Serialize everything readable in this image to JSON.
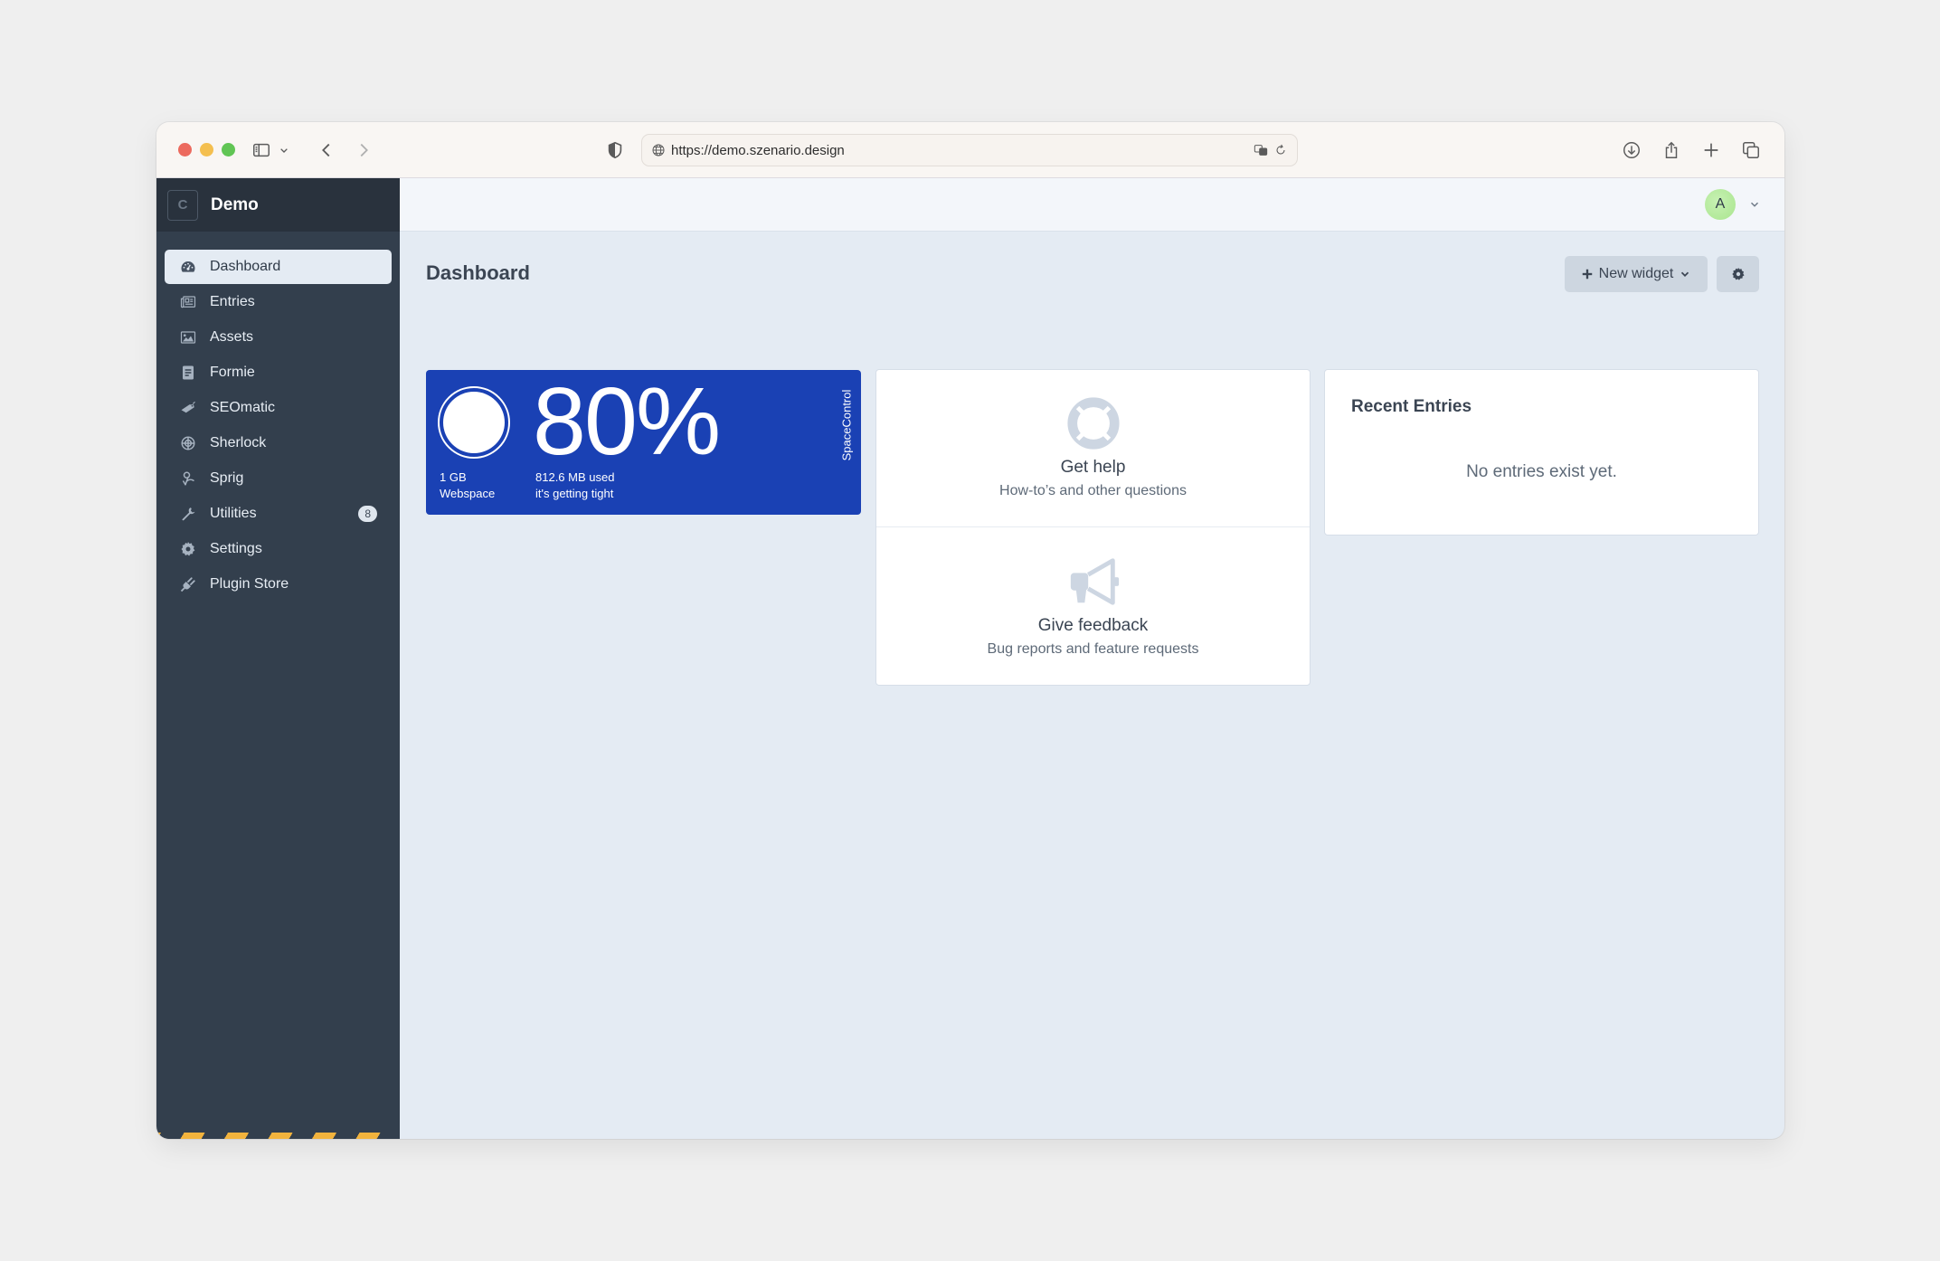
{
  "browser": {
    "url": "https://demo.szenario.design",
    "icons": [
      "sidebar-icon",
      "chevron-down-icon",
      "back-icon",
      "forward-icon",
      "shield-icon",
      "globe-icon",
      "translate-icon",
      "reload-icon",
      "download-icon",
      "share-icon",
      "new-tab-icon",
      "tabs-overview-icon"
    ]
  },
  "sidebar": {
    "logo_letter": "C",
    "site_name": "Demo",
    "items": [
      {
        "label": "Dashboard",
        "icon": "gauge-icon",
        "active": true
      },
      {
        "label": "Entries",
        "icon": "newspaper-icon"
      },
      {
        "label": "Assets",
        "icon": "image-icon"
      },
      {
        "label": "Formie",
        "icon": "form-icon"
      },
      {
        "label": "SEOmatic",
        "icon": "seo-tag-icon"
      },
      {
        "label": "Sherlock",
        "icon": "crosshair-globe-icon"
      },
      {
        "label": "Sprig",
        "icon": "sprig-icon"
      },
      {
        "label": "Utilities",
        "icon": "wrench-icon",
        "badge": "8"
      },
      {
        "label": "Settings",
        "icon": "gear-icon"
      },
      {
        "label": "Plugin Store",
        "icon": "plug-icon"
      }
    ],
    "hazard_stripe_color": "#f2b33d"
  },
  "header": {
    "avatar_letter": "A"
  },
  "page": {
    "title": "Dashboard",
    "new_widget_label": "New widget",
    "settings_icon": "gear-icon"
  },
  "widgets": {
    "space": {
      "percent": "80%",
      "usage_fraction": 0.8,
      "total": "1 GB",
      "total_label": "Webspace",
      "used": "812.6 MB used",
      "status": "it's getting tight",
      "brand": "SpaceControl",
      "color": "#1a41b4"
    },
    "help": {
      "get_help_title": "Get help",
      "get_help_sub": "How-to’s and other questions",
      "feedback_title": "Give feedback",
      "feedback_sub": "Bug reports and feature requests"
    },
    "recent": {
      "title": "Recent Entries",
      "empty": "No entries exist yet."
    }
  }
}
